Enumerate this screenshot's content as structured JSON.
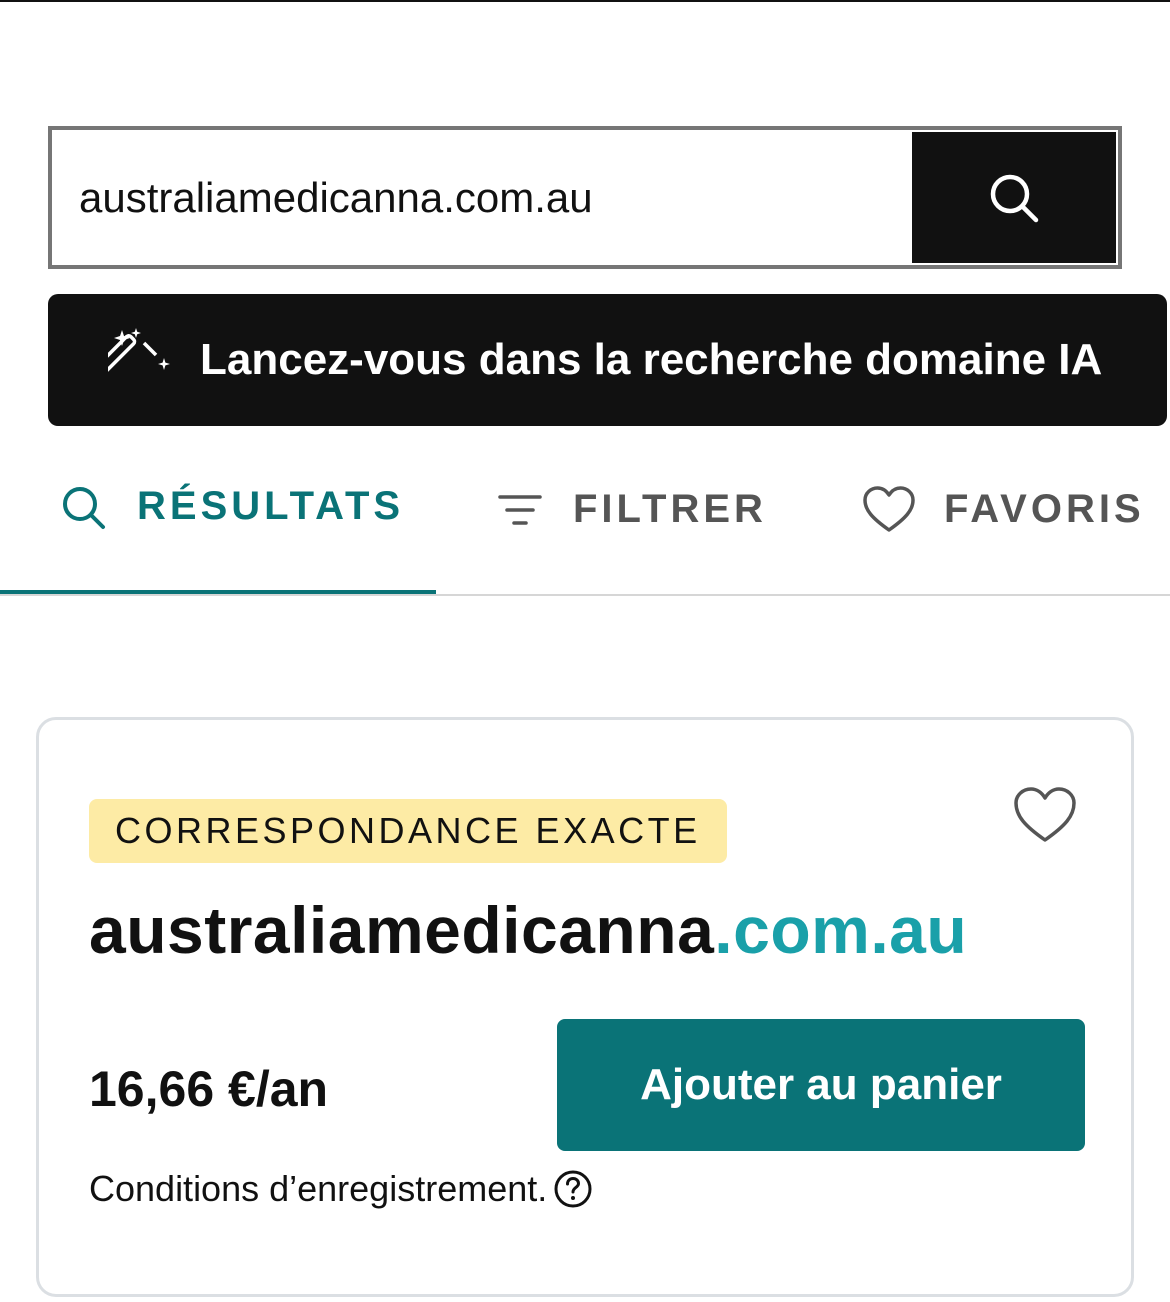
{
  "search": {
    "value": "australiamedicanna.com.au",
    "button_icon": "search-icon"
  },
  "ai_banner": {
    "icon": "magic-wand-icon",
    "label": "Lancez-vous dans la recherche domaine IA"
  },
  "tabs": [
    {
      "label": "RÉSULTATS",
      "icon": "search-icon",
      "active": true
    },
    {
      "label": "FILTRER",
      "icon": "filter-icon",
      "active": false
    },
    {
      "label": "FAVORIS",
      "icon": "heart-icon",
      "active": false
    }
  ],
  "result": {
    "badge": "CORRESPONDANCE EXACTE",
    "domain_name": "australiamedicanna",
    "domain_tld": ".com.au",
    "price": "16,66 €/an",
    "add_to_cart": "Ajouter au panier",
    "terms": "Conditions d’enregistrement.",
    "favorite_icon": "heart-icon",
    "help_icon": "question-circle-icon"
  },
  "colors": {
    "accent_teal": "#0a7377",
    "tld_teal": "#1aa0a9",
    "badge_yellow": "#fdeba5",
    "dark": "#111111"
  }
}
